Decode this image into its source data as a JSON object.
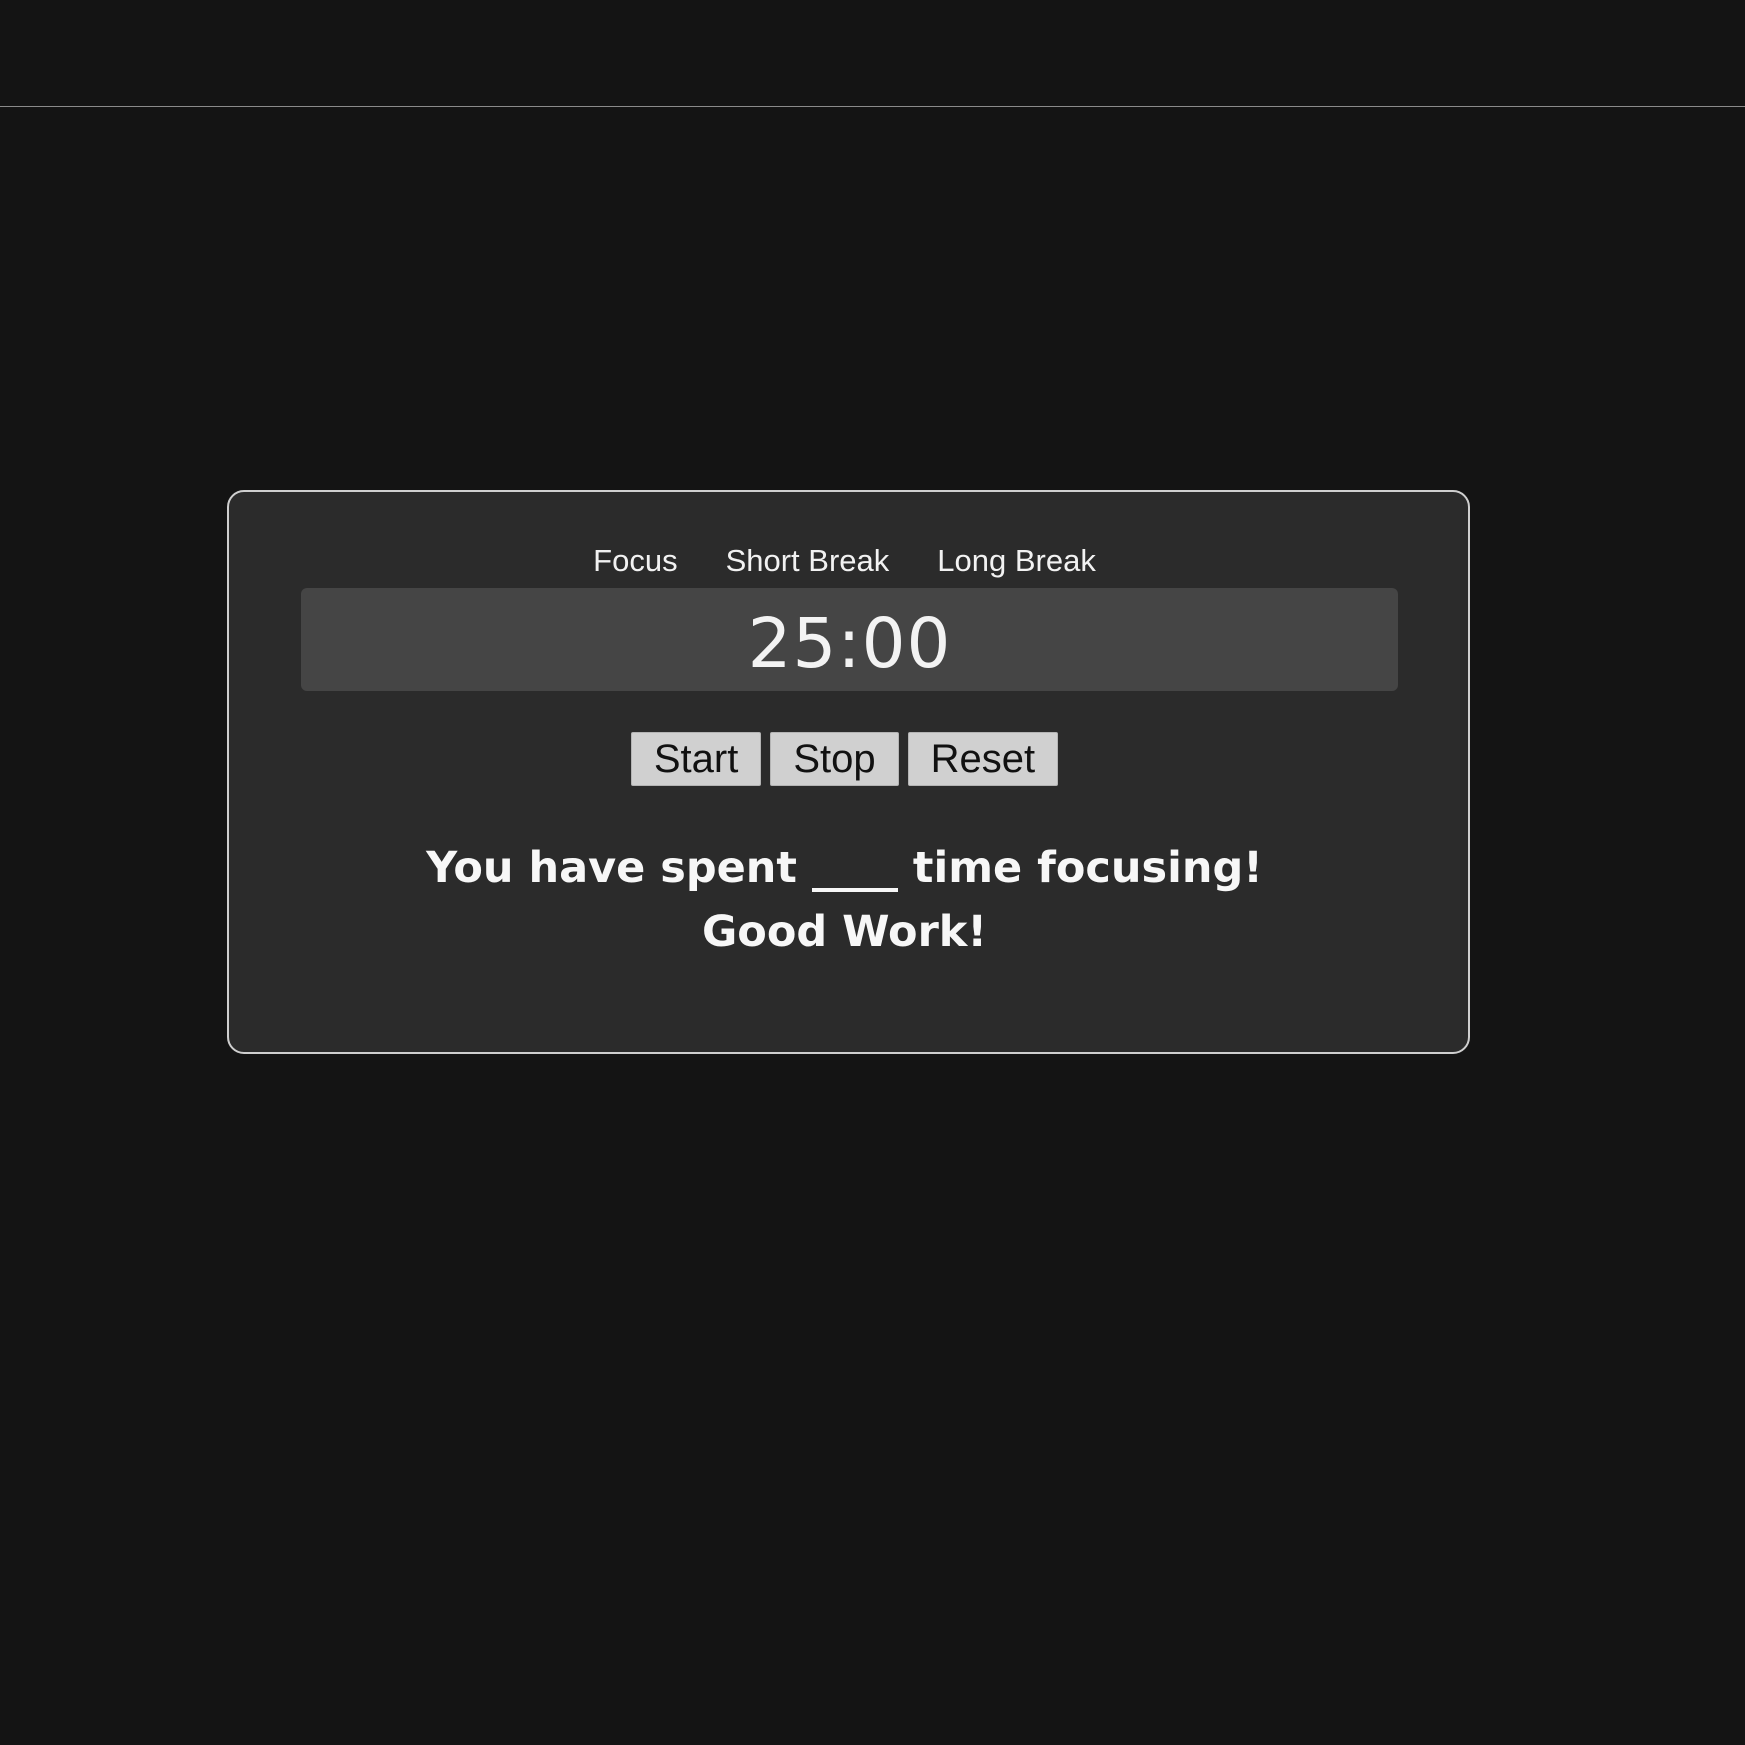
{
  "modes": {
    "focus": "Focus",
    "short_break": "Short Break",
    "long_break": "Long Break"
  },
  "timer": {
    "display": "25:00"
  },
  "controls": {
    "start": "Start",
    "stop": "Stop",
    "reset": "Reset"
  },
  "summary": {
    "line1": "You have spent ____ time focusing!",
    "line2": "Good Work!"
  },
  "colors": {
    "page_background": "#141414",
    "card_background": "#2b2b2b",
    "time_background": "#454545",
    "button_background": "#d0d0d0",
    "text": "#f2f2f2"
  }
}
